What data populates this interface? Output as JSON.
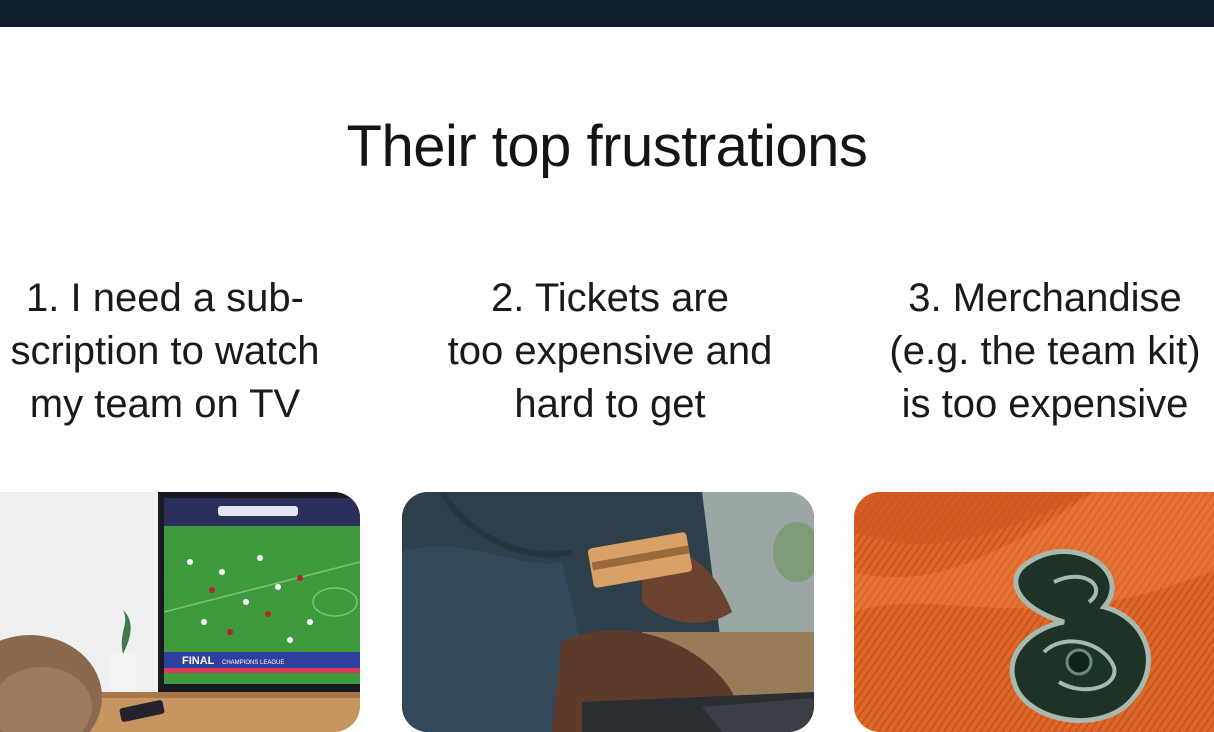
{
  "section": {
    "title": "Their top frustrations"
  },
  "frustrations": [
    {
      "lines": [
        "1. I need a sub-",
        "scription to watch",
        "my team on TV"
      ],
      "image_alt": "Person watching a football match on TV"
    },
    {
      "lines": [
        "2. Tickets are",
        "too expensive and",
        "hard to get"
      ],
      "image_alt": "Person holding a credit card while typing on a laptop"
    },
    {
      "lines": [
        "3. Merchandise",
        "(e.g. the team kit)",
        "is too expensive"
      ],
      "image_alt": "Close-up of an orange team jersey with an embroidered badge"
    }
  ],
  "tv_overlay": {
    "banner": "FINAL",
    "banner_sub": "CHAMPIONS LEAGUE"
  },
  "colors": {
    "topbar": "#0e1c2c",
    "text": "#141414",
    "jersey": "#e0672a",
    "pitch": "#3f9a3e"
  }
}
